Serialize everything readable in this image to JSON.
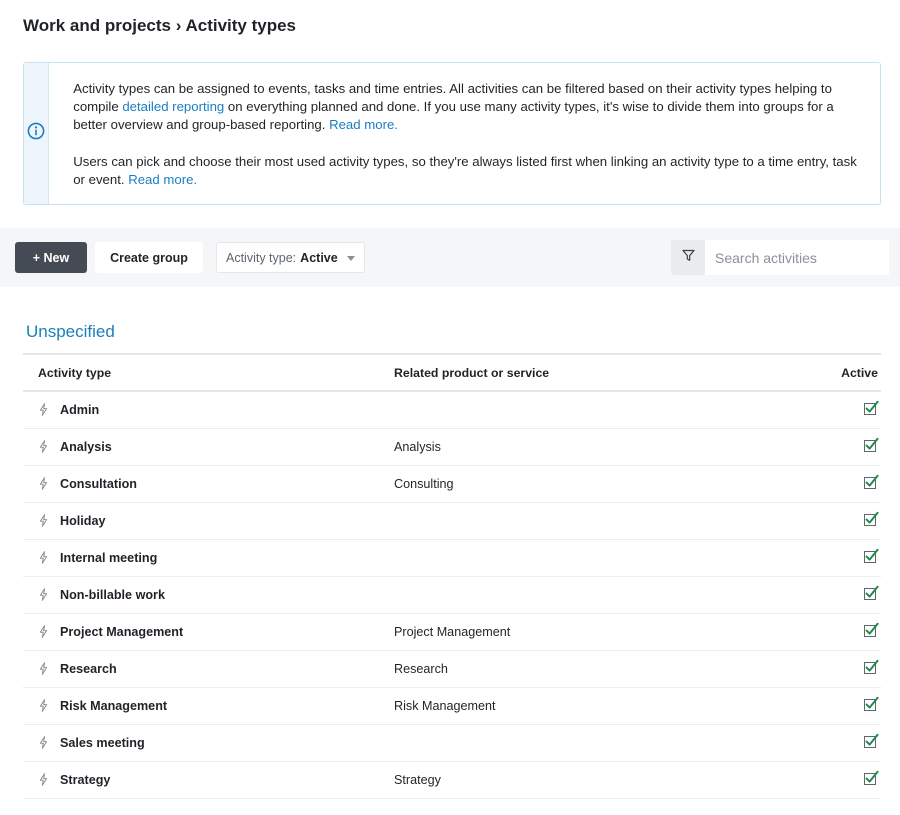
{
  "header": {
    "breadcrumb": "Work and projects › Activity types"
  },
  "info": {
    "icon": "info-icon",
    "p1_a": "Activity types can be assigned to events, tasks and time entries. All activities can be filtered based on their activity types helping to compile ",
    "p1_link": "detailed reporting",
    "p1_b": " on everything planned and done. If you use many activity types, it's wise to divide them into groups for a better overview and group-based reporting. ",
    "p1_read_more": "Read more.",
    "p2_a": "Users can pick and choose their most used activity types, so they're always listed first when linking an activity type to a time entry, task or event. ",
    "p2_read_more": "Read more."
  },
  "toolbar": {
    "new_label": "+ New",
    "create_group_label": "Create group",
    "filter_prefix": "Activity type:",
    "filter_value": "Active",
    "search_placeholder": "Search activities"
  },
  "group": {
    "title": "Unspecified",
    "columns": [
      "Activity type",
      "Related product or service",
      "Active"
    ],
    "rows": [
      {
        "name": "Admin",
        "related": "",
        "active": true
      },
      {
        "name": "Analysis",
        "related": "Analysis",
        "active": true
      },
      {
        "name": "Consultation",
        "related": "Consulting",
        "active": true
      },
      {
        "name": "Holiday",
        "related": "",
        "active": true
      },
      {
        "name": "Internal meeting",
        "related": "",
        "active": true
      },
      {
        "name": "Non-billable work",
        "related": "",
        "active": true
      },
      {
        "name": "Project Management",
        "related": "Project Management",
        "active": true
      },
      {
        "name": "Research",
        "related": "Research",
        "active": true
      },
      {
        "name": "Risk Management",
        "related": "Risk Management",
        "active": true
      },
      {
        "name": "Sales meeting",
        "related": "",
        "active": true
      },
      {
        "name": "Strategy",
        "related": "Strategy",
        "active": true
      }
    ]
  },
  "colors": {
    "accent": "#1a7fc1",
    "primary_button": "#454b54",
    "check_green": "#1f8a4c"
  }
}
